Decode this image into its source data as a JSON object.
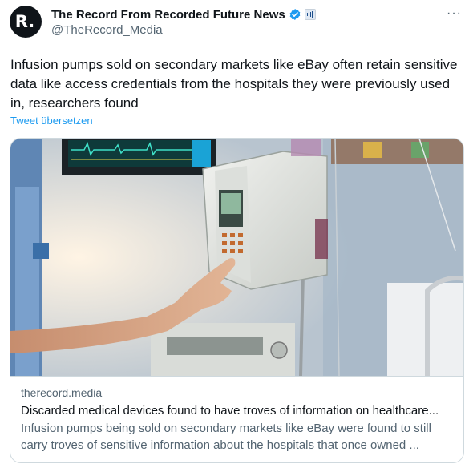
{
  "author": {
    "avatar_letter": "R.",
    "display_name": "The Record From Recorded Future News",
    "handle": "@TheRecord_Media",
    "verified_color": "#1d9bf0"
  },
  "menu": {
    "more_label": "···"
  },
  "tweet": {
    "text": "Infusion pumps sold on secondary markets like eBay often retain sensitive data like access credentials from the hospitals they were previously used in, researchers found",
    "translate_label": "Tweet übersetzen"
  },
  "card": {
    "domain": "therecord.media",
    "title": "Discarded medical devices found to have troves of information on healthcare...",
    "description": "Infusion pumps being sold on secondary markets like eBay were found to still carry troves of sensitive information about the hospitals that once owned ..."
  },
  "colors": {
    "link": "#1d9bf0",
    "secondary_text": "#536471",
    "brand_accent": "#f26a1b"
  }
}
